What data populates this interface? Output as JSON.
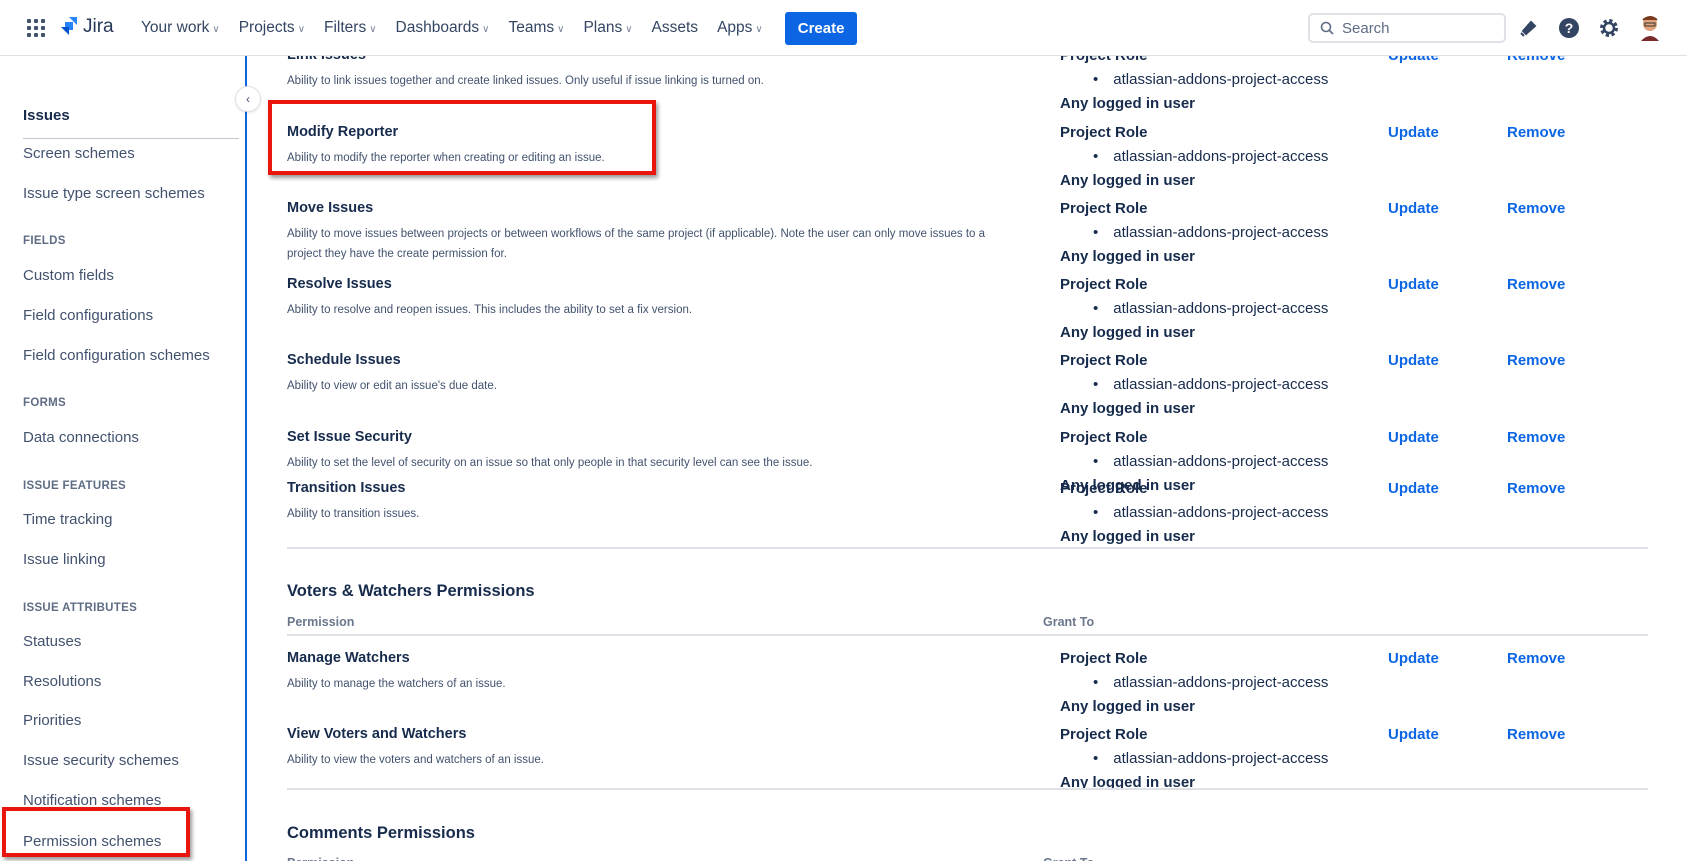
{
  "topnav": {
    "app": "Jira",
    "items": [
      {
        "label": "Your work",
        "dropdown": true
      },
      {
        "label": "Projects",
        "dropdown": true
      },
      {
        "label": "Filters",
        "dropdown": true
      },
      {
        "label": "Dashboards",
        "dropdown": true
      },
      {
        "label": "Teams",
        "dropdown": true
      },
      {
        "label": "Plans",
        "dropdown": true
      },
      {
        "label": "Assets",
        "dropdown": false
      },
      {
        "label": "Apps",
        "dropdown": true
      }
    ],
    "create": "Create",
    "search_placeholder": "Search"
  },
  "sidebar": {
    "items": [
      {
        "label": "Issues",
        "type": "title"
      },
      {
        "label": "Screen schemes"
      },
      {
        "label": "Issue type screen schemes"
      },
      {
        "label": "FIELDS",
        "type": "h"
      },
      {
        "label": "Custom fields"
      },
      {
        "label": "Field configurations"
      },
      {
        "label": "Field configuration schemes"
      },
      {
        "label": "FORMS",
        "type": "h"
      },
      {
        "label": "Data connections"
      },
      {
        "label": "ISSUE FEATURES",
        "type": "h"
      },
      {
        "label": "Time tracking"
      },
      {
        "label": "Issue linking"
      },
      {
        "label": "ISSUE ATTRIBUTES",
        "type": "h"
      },
      {
        "label": "Statuses"
      },
      {
        "label": "Resolutions"
      },
      {
        "label": "Priorities"
      },
      {
        "label": "Issue security schemes"
      },
      {
        "label": "Notification schemes"
      },
      {
        "label": "Permission schemes",
        "highlighted": true
      }
    ]
  },
  "grant": {
    "role": "Project Role",
    "role_member": "atlassian-addons-project-access",
    "any": "Any logged in user",
    "update": "Update",
    "remove": "Remove"
  },
  "issue_rows": [
    {
      "title": "Link Issues",
      "desc": "Ability to link issues together and create linked issues. Only useful if issue linking is turned on."
    },
    {
      "title": "Modify Reporter",
      "desc": "Ability to modify the reporter when creating or editing an issue.",
      "highlighted": true
    },
    {
      "title": "Move Issues",
      "desc": "Ability to move issues between projects or between workflows of the same project (if applicable). Note the user can only move issues to a project they have the create permission for."
    },
    {
      "title": "Resolve Issues",
      "desc": "Ability to resolve and reopen issues. This includes the ability to set a fix version."
    },
    {
      "title": "Schedule Issues",
      "desc": "Ability to view or edit an issue's due date."
    },
    {
      "title": "Set Issue Security",
      "desc": "Ability to set the level of security on an issue so that only people in that security level can see the issue."
    },
    {
      "title": "Transition Issues",
      "desc": "Ability to transition issues."
    }
  ],
  "voters_section": {
    "title": "Voters & Watchers Permissions",
    "col_permission": "Permission",
    "col_grant": "Grant To",
    "rows": [
      {
        "title": "Manage Watchers",
        "desc": "Ability to manage the watchers of an issue."
      },
      {
        "title": "View Voters and Watchers",
        "desc": "Ability to view the voters and watchers of an issue."
      }
    ]
  },
  "comments_section": {
    "title": "Comments Permissions",
    "col_permission": "Permission",
    "col_grant": "Grant To"
  }
}
